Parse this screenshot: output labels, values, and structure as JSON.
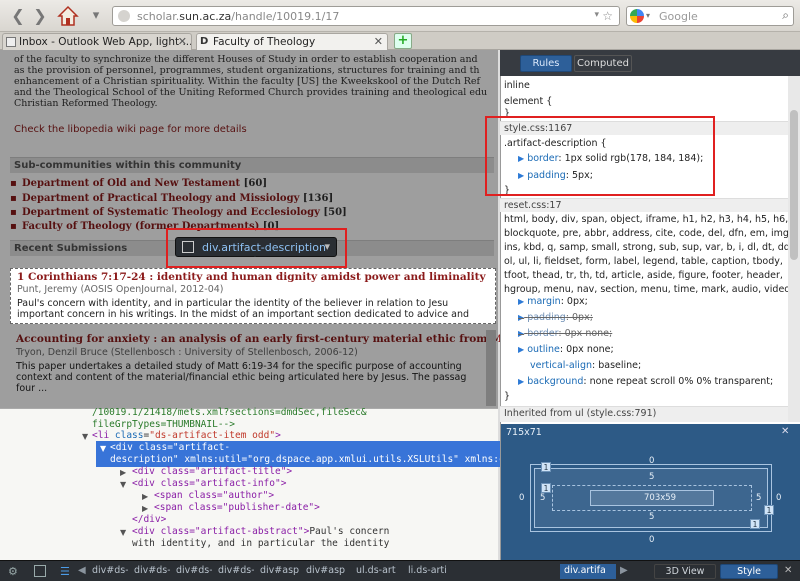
{
  "toolbar": {
    "url_prefix": "scholar.",
    "url_domain": "sun.ac.za",
    "url_path": "/handle/10019.1/17",
    "search_placeholder": "Google",
    "search_engine_icon": "google-icon"
  },
  "tabs": [
    {
      "label": "Inbox - Outlook Web App, light ...",
      "active": false
    },
    {
      "label": "Faculty of Theology",
      "active": true
    }
  ],
  "page": {
    "intro_lines": [
      "of the faculty to synchronize the different Houses of Study in order to establish cooperation and",
      "as the provision of personnel, programmes, student organizations, structures for training and th",
      "enhancement of a Christian spirituality. Within the faculty [US] the Kweekskool of the Dutch Ref",
      "and the Theological School of the Uniting Reformed Church provides training and theological edu",
      "Christian Reformed Theology."
    ],
    "wiki_link": "Check the libopedia wiki page for more details",
    "subcommunities_heading": "Sub-communities within this community",
    "subcommunities": [
      {
        "name": "Department of Old and New Testament",
        "count": "[60]"
      },
      {
        "name": "Department of Practical Theology and Missiology",
        "count": "[136]"
      },
      {
        "name": "Department of Systematic Theology and Ecclesiology",
        "count": "[50]"
      },
      {
        "name": "Faculty of Theology (former Departments)",
        "count": "[0]"
      }
    ],
    "recent_heading": "Recent Submissions",
    "items": [
      {
        "title": "1 Corinthians 7:17-24 : identity and human dignity amidst power and liminality",
        "info": "Punt, Jeremy (AOSIS OpenJournal, 2012-04)",
        "abstract": [
          "Paul's concern with identity, and in particular the identity of the believer in relation to Jesu",
          "important concern in his writings. In the midst of an important section dedicated to advice and"
        ]
      },
      {
        "title": "Accounting for anxiety : an analysis of an early first-century material ethic from M",
        "info": "Tryon, Denzil Bruce (Stellenbosch : University of Stellenbosch, 2006-12)",
        "abstract": [
          "This paper undertakes a detailed study of Matt 6:19-34 for the specific purpose of accounting",
          "context and content of the material/financial ethic being articulated here by Jesus. The passag",
          "four ..."
        ]
      }
    ],
    "element_tooltip": {
      "tag": "div",
      "class": ".artifact-description"
    }
  },
  "markup": {
    "line0": "/10019.1/21418/mets.xml?sections=dmdSec,fileSec&",
    "line1": "fileGrpTypes=THUMBNAIL-->",
    "li_tag": "<li ",
    "li_attr": "class",
    "li_val": "\"ds-artifact-item odd\"",
    "sel1": "<div class=\"artifact-",
    "sel2": "description\" xmlns:util=\"org.dspace.app.xmlui.utils.XSLUtils\" xmlns:c",
    "title_div": "<div class=\"artifact-title\">",
    "info_div": "<div class=\"artifact-info\">",
    "author_span": "<span class=\"author\">",
    "date_span": "<span class=\"publisher-date\">",
    "close_div": "</div>",
    "abstract_div": "<div class=\"artifact-abstract\">",
    "abstract_text": "Paul's concern",
    "abstract_text2": "with identity, and in particular the identity"
  },
  "rules": {
    "tab_rules": "Rules",
    "tab_computed": "Computed",
    "inline": "inline",
    "element_open": "element {",
    "close_brace": "}",
    "src1": "style.css:1167",
    "sel1": ".artifact-description {",
    "decl1_name": "border",
    "decl1_val": ": 1px solid rgb(178, 184, 184);",
    "decl2_name": "padding",
    "decl2_val": ": 5px;",
    "src2": "reset.css:17",
    "reset_selector": [
      "html, body, div, span, object, iframe, h1, h2, h3, h4, h5, h6, p,",
      "blockquote, pre, abbr, address, cite, code, del, dfn, em, img,",
      "ins, kbd, q, samp, small, strong, sub, sup, var, b, i, dl, dt, dd,",
      "ol, ul, li, fieldset, form, label, legend, table, caption, tbody,",
      "tfoot, thead, tr, th, td, article, aside, figure, footer, header,",
      "hgroup, menu, nav, section, menu, time, mark, audio, video {"
    ],
    "r_margin_name": "margin",
    "r_margin_val": ": 0px;",
    "r_padding_name": "padding",
    "r_padding_val": ": 0px;",
    "r_border_name": "border",
    "r_border_val": ": 0px none;",
    "r_outline_name": "outline",
    "r_outline_val": ": 0px none;",
    "r_valign_name": "vertical-align",
    "r_valign_val": ": baseline;",
    "r_bg_name": "background",
    "r_bg_val": ": none repeat scroll 0% 0% transparent;",
    "inherited": "Inherited from ul (style.css:791)"
  },
  "layout": {
    "size": "715x71",
    "margin": "0",
    "border": "1",
    "padding": "5",
    "content": "703x59"
  },
  "devbar": {
    "crumbs": [
      "div#ds-r",
      "div#ds-c",
      "div#ds-b",
      "div#ds-b",
      "div#asp",
      "div#asp",
      "ul.ds-art",
      "li.ds-arti",
      "div.artifa"
    ],
    "btn_3d": "3D View",
    "btn_style": "Style"
  },
  "colors": {
    "accent": "#2d5f99",
    "link": "#8b1a1a",
    "highlight_box": "#e02020"
  }
}
